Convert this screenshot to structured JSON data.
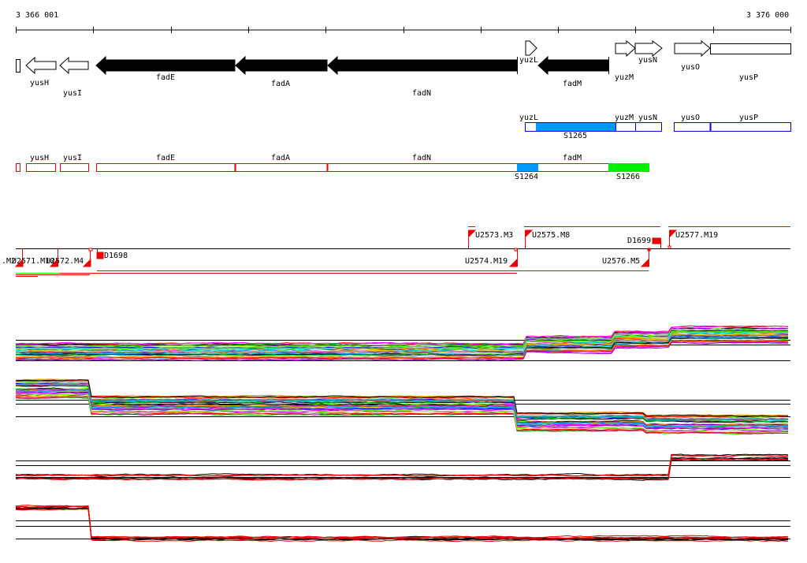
{
  "ruler": {
    "start": "3 366 001",
    "end": "3 376 000"
  },
  "genes": [
    {
      "name": "yusH",
      "strand": "-"
    },
    {
      "name": "yusI",
      "strand": "-"
    },
    {
      "name": "fadE",
      "strand": "-"
    },
    {
      "name": "fadA",
      "strand": "-"
    },
    {
      "name": "fadN",
      "strand": "-"
    },
    {
      "name": "yuzL",
      "strand": "+"
    },
    {
      "name": "fadM",
      "strand": "-"
    },
    {
      "name": "yuzM",
      "strand": "+"
    },
    {
      "name": "yusN",
      "strand": "+"
    },
    {
      "name": "yusO",
      "strand": "+"
    },
    {
      "name": "yusP",
      "strand": "+"
    }
  ],
  "plus_operons": {
    "labels": [
      "yuzL",
      "yuzM",
      "yusN",
      "yusO",
      "yusP"
    ],
    "segment": "S1265"
  },
  "minus_operons": {
    "labels": [
      "yusH",
      "yusI",
      "fadE",
      "fadA",
      "fadN",
      "fadM"
    ],
    "segments": [
      "S1264",
      "S1266"
    ]
  },
  "features": {
    "upper": [
      "U2573.M3",
      "U2575.M8",
      "D1699",
      "U2577.M19"
    ],
    "lower": [
      ".M2",
      "U2571.M10",
      "U2572.M4",
      "D1698",
      "U2574.M19",
      "U2576.M5"
    ]
  },
  "colors": {
    "plus": "#0000dd",
    "minus": "#ee0000",
    "segment_blue": "#0099ff",
    "segment_green": "#00ee00"
  }
}
